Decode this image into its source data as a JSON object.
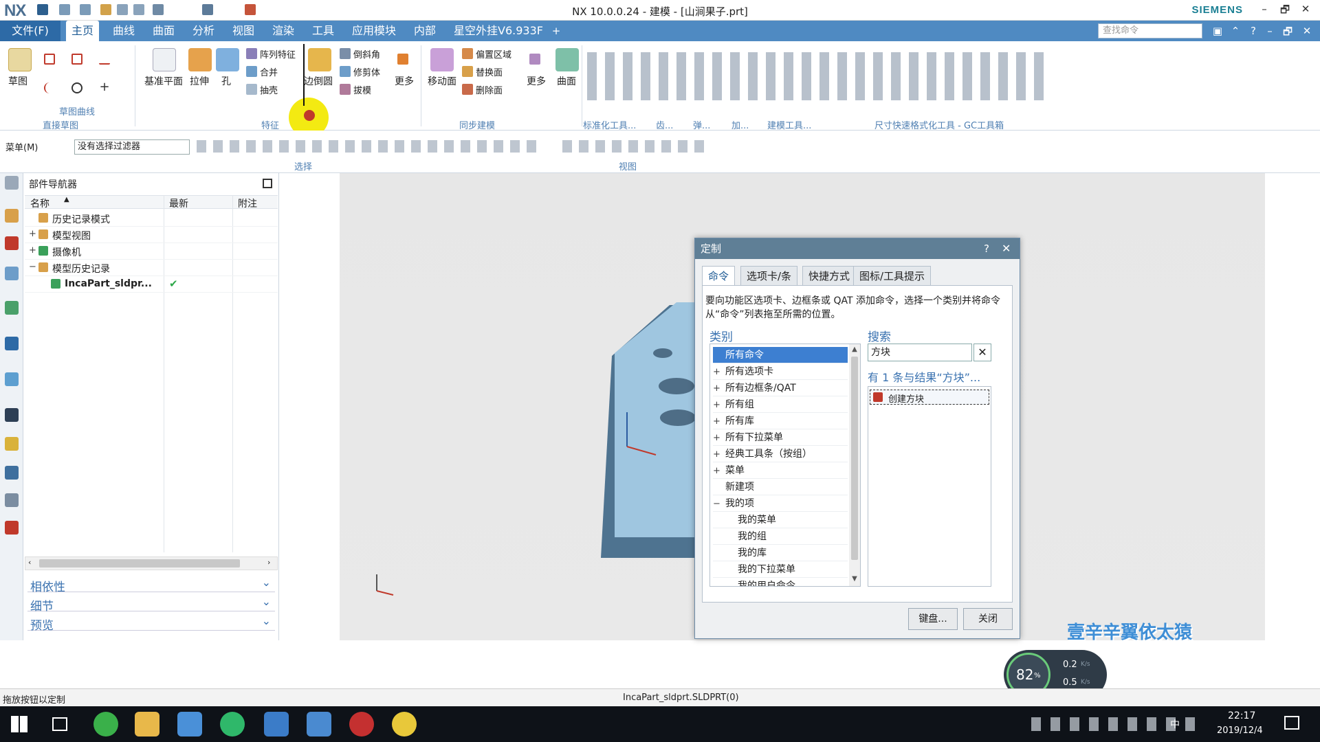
{
  "titlebar": {
    "logo": "NX",
    "title": "NX 10.0.0.24 - 建模 - [山涧果子.prt]",
    "brand": "SIEMENS",
    "window_buttons": [
      "–",
      "🗗",
      "✕"
    ]
  },
  "tabs": {
    "file": "文件(F)",
    "items": [
      "主页",
      "曲线",
      "曲面",
      "分析",
      "视图",
      "渲染",
      "工具",
      "应用模块",
      "内部",
      "星空外挂V6.933F"
    ],
    "active_index": 0,
    "search_placeholder": "查找命令"
  },
  "ribbon": {
    "sketch": {
      "big_label": "草图",
      "group_sub": "草图曲线",
      "group": "直接草图"
    },
    "feature": {
      "items": [
        "基准平面",
        "拉伸",
        "孔"
      ],
      "small": [
        "阵列特征",
        "合并",
        "抽壳"
      ],
      "edge": "边倒圆",
      "small2": [
        "倒斜角",
        "修剪体",
        "拔模"
      ],
      "more": "更多",
      "group": "特征"
    },
    "sync": {
      "move": "移动面",
      "small": [
        "偏置区域",
        "替换面",
        "删除面"
      ],
      "more": "更多",
      "surface": "曲面",
      "group": "同步建模"
    },
    "groups_right": [
      "标准化工具...",
      "齿...",
      "弹...",
      "加...",
      "建模工具...",
      "尺寸快速格式化工具 - GC工具箱"
    ]
  },
  "selbar": {
    "menu": "菜单(M)",
    "filter": "没有选择过滤器",
    "group_select": "选择",
    "group_view": "视图"
  },
  "navigator": {
    "title": "部件导航器",
    "columns": [
      "名称",
      "最新",
      "附注"
    ],
    "rows": [
      {
        "label": "历史记录模式",
        "indent": 0,
        "prefix": "",
        "checked": false
      },
      {
        "label": "模型视图",
        "indent": 0,
        "prefix": "+",
        "checked": false
      },
      {
        "label": "摄像机",
        "indent": 0,
        "prefix": "+",
        "checked": true
      },
      {
        "label": "模型历史记录",
        "indent": 0,
        "prefix": "−",
        "checked": false
      },
      {
        "label": "IncaPart_sldpr...",
        "indent": 1,
        "prefix": "",
        "checked": true,
        "latest": "✔"
      }
    ],
    "panels": [
      "相依性",
      "细节",
      "预览"
    ]
  },
  "dialog": {
    "title": "定制",
    "tabs": [
      "命令",
      "选项卡/条",
      "快捷方式",
      "图标/工具提示"
    ],
    "active_tab": 0,
    "description": "要向功能区选项卡、边框条或 QAT 添加命令，选择一个类别并将命令从“命令”列表拖至所需的位置。",
    "category_label": "类别",
    "categories": [
      {
        "label": "所有命令",
        "prefix": "",
        "sel": true,
        "indent": 0
      },
      {
        "label": "所有选项卡",
        "prefix": "+",
        "sel": false,
        "indent": 0
      },
      {
        "label": "所有边框条/QAT",
        "prefix": "+",
        "sel": false,
        "indent": 0
      },
      {
        "label": "所有组",
        "prefix": "+",
        "sel": false,
        "indent": 0
      },
      {
        "label": "所有库",
        "prefix": "+",
        "sel": false,
        "indent": 0
      },
      {
        "label": "所有下拉菜单",
        "prefix": "+",
        "sel": false,
        "indent": 0
      },
      {
        "label": "经典工具条（按组）",
        "prefix": "+",
        "sel": false,
        "indent": 0
      },
      {
        "label": "菜单",
        "prefix": "+",
        "sel": false,
        "indent": 0
      },
      {
        "label": "新建项",
        "prefix": "",
        "sel": false,
        "indent": 0
      },
      {
        "label": "我的项",
        "prefix": "−",
        "sel": false,
        "indent": 0
      },
      {
        "label": "我的菜单",
        "prefix": "",
        "sel": false,
        "indent": 1
      },
      {
        "label": "我的组",
        "prefix": "",
        "sel": false,
        "indent": 1
      },
      {
        "label": "我的库",
        "prefix": "",
        "sel": false,
        "indent": 1
      },
      {
        "label": "我的下拉菜单",
        "prefix": "",
        "sel": false,
        "indent": 1
      },
      {
        "label": "我的用户命令",
        "prefix": "",
        "sel": false,
        "indent": 1
      }
    ],
    "search_label": "搜索",
    "search_value": "方块",
    "result_label": "有 1 条与结果“方块”...",
    "results": [
      "创建方块"
    ],
    "buttons": {
      "keyboard": "键盘...",
      "close": "关闭"
    }
  },
  "status": {
    "left": "拖放按钮以定制",
    "center": "IncaPart_sldprt.SLDPRT(0)"
  },
  "widget": {
    "percent": "82",
    "percent_unit": "%",
    "up": "0.2",
    "down": "0.5",
    "rate_unit": "K/s"
  },
  "watermark": "壹辛辛翼依太猿",
  "taskbar": {
    "time": "22:17",
    "date": "2019/12/4",
    "ime": "中"
  },
  "colors": {
    "accent": "#4f8ac2",
    "selected": "#3d7fd1",
    "model": "#9fc6e0",
    "dialog_title": "#5f7f96"
  }
}
